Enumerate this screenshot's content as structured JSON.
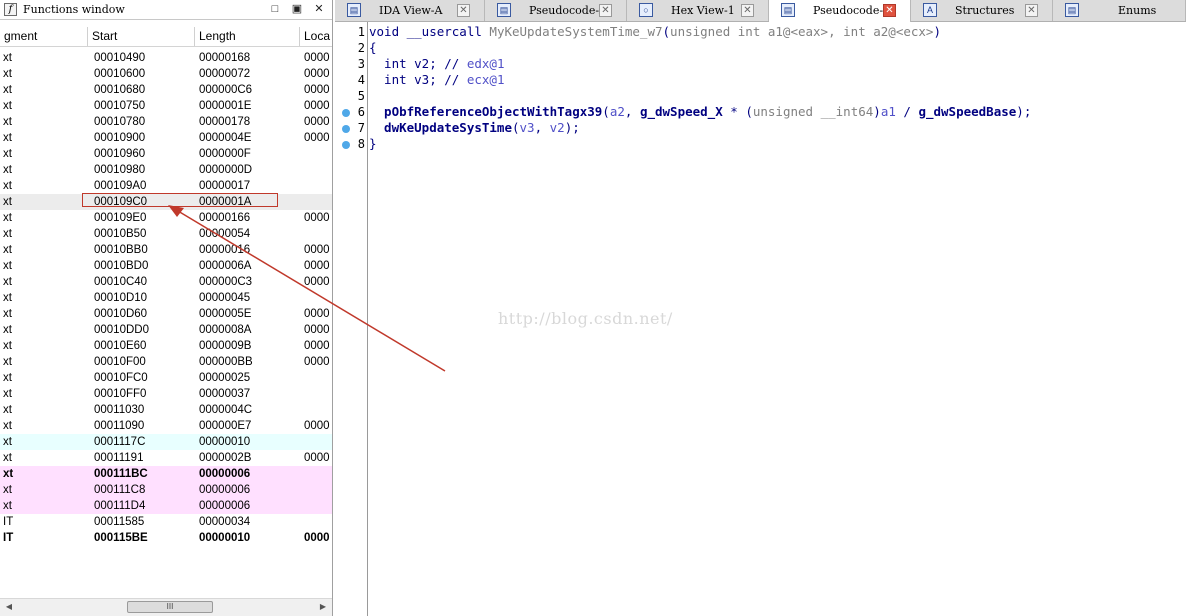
{
  "functions_window": {
    "title": "Functions window",
    "icon": "function-icon",
    "window_buttons": [
      "□",
      "▣",
      "✕"
    ],
    "columns": [
      "gment",
      "Start",
      "Length",
      "Loca"
    ],
    "rows": [
      {
        "seg": "xt",
        "start": "00010490",
        "length": "00000168",
        "loc": "0000",
        "style": ""
      },
      {
        "seg": "xt",
        "start": "00010600",
        "length": "00000072",
        "loc": "0000",
        "style": ""
      },
      {
        "seg": "xt",
        "start": "00010680",
        "length": "000000C6",
        "loc": "0000",
        "style": ""
      },
      {
        "seg": "xt",
        "start": "00010750",
        "length": "0000001E",
        "loc": "0000",
        "style": ""
      },
      {
        "seg": "xt",
        "start": "00010780",
        "length": "00000178",
        "loc": "0000",
        "style": ""
      },
      {
        "seg": "xt",
        "start": "00010900",
        "length": "0000004E",
        "loc": "0000",
        "style": ""
      },
      {
        "seg": "xt",
        "start": "00010960",
        "length": "0000000F",
        "loc": "",
        "style": ""
      },
      {
        "seg": "xt",
        "start": "00010980",
        "length": "0000000D",
        "loc": "",
        "style": ""
      },
      {
        "seg": "xt",
        "start": "000109A0",
        "length": "00000017",
        "loc": "",
        "style": ""
      },
      {
        "seg": "xt",
        "start": "000109C0",
        "length": "0000001A",
        "loc": "",
        "style": "sel"
      },
      {
        "seg": "xt",
        "start": "000109E0",
        "length": "00000166",
        "loc": "0000",
        "style": ""
      },
      {
        "seg": "xt",
        "start": "00010B50",
        "length": "00000054",
        "loc": "",
        "style": ""
      },
      {
        "seg": "xt",
        "start": "00010BB0",
        "length": "00000016",
        "loc": "0000",
        "style": ""
      },
      {
        "seg": "xt",
        "start": "00010BD0",
        "length": "0000006A",
        "loc": "0000",
        "style": ""
      },
      {
        "seg": "xt",
        "start": "00010C40",
        "length": "000000C3",
        "loc": "0000",
        "style": ""
      },
      {
        "seg": "xt",
        "start": "00010D10",
        "length": "00000045",
        "loc": "",
        "style": ""
      },
      {
        "seg": "xt",
        "start": "00010D60",
        "length": "0000005E",
        "loc": "0000",
        "style": ""
      },
      {
        "seg": "xt",
        "start": "00010DD0",
        "length": "0000008A",
        "loc": "0000",
        "style": ""
      },
      {
        "seg": "xt",
        "start": "00010E60",
        "length": "0000009B",
        "loc": "0000",
        "style": ""
      },
      {
        "seg": "xt",
        "start": "00010F00",
        "length": "000000BB",
        "loc": "0000",
        "style": ""
      },
      {
        "seg": "xt",
        "start": "00010FC0",
        "length": "00000025",
        "loc": "",
        "style": ""
      },
      {
        "seg": "xt",
        "start": "00010FF0",
        "length": "00000037",
        "loc": "",
        "style": ""
      },
      {
        "seg": "xt",
        "start": "00011030",
        "length": "0000004C",
        "loc": "",
        "style": ""
      },
      {
        "seg": "xt",
        "start": "00011090",
        "length": "000000E7",
        "loc": "0000",
        "style": ""
      },
      {
        "seg": "xt",
        "start": "0001117C",
        "length": "00000010",
        "loc": "",
        "style": "cyan"
      },
      {
        "seg": "xt",
        "start": "00011191",
        "length": "0000002B",
        "loc": "0000",
        "style": ""
      },
      {
        "seg": "xt",
        "start": "000111BC",
        "length": "00000006",
        "loc": "",
        "style": "pink bold"
      },
      {
        "seg": "xt",
        "start": "000111C8",
        "length": "00000006",
        "loc": "",
        "style": "pink"
      },
      {
        "seg": "xt",
        "start": "000111D4",
        "length": "00000006",
        "loc": "",
        "style": "pink"
      },
      {
        "seg": "IT",
        "start": "00011585",
        "length": "00000034",
        "loc": "",
        "style": ""
      },
      {
        "seg": "IT",
        "start": "000115BE",
        "length": "00000010",
        "loc": "0000",
        "style": "bold"
      }
    ],
    "scrollbar_thumb": "III"
  },
  "tabs": [
    {
      "label": "IDA View-A",
      "icon": "ida-view-icon",
      "active": false,
      "close_red": false
    },
    {
      "label": "Pseudocode-A",
      "icon": "pseudocode-icon",
      "active": false,
      "close_red": false
    },
    {
      "label": "Hex View-1",
      "icon": "hex-view-icon",
      "active": false,
      "close_red": false
    },
    {
      "label": "Pseudocode-B",
      "icon": "pseudocode-icon",
      "active": true,
      "close_red": true
    },
    {
      "label": "Structures",
      "icon": "structures-icon",
      "active": false,
      "close_red": false
    },
    {
      "label": "Enums",
      "icon": "enums-icon",
      "active": false,
      "close_red": false
    }
  ],
  "pseudocode": {
    "lines": [
      {
        "n": "1",
        "dot": false,
        "tokens": [
          [
            "kw",
            "void __usercall "
          ],
          [
            "gr",
            "MyKeUpdateSystemTime_w7"
          ],
          [
            "kw",
            "("
          ],
          [
            "gr",
            "unsigned int a1@<eax>, int a2@<ecx>"
          ],
          [
            "kw",
            ")"
          ]
        ]
      },
      {
        "n": "2",
        "dot": false,
        "tokens": [
          [
            "kw",
            "{"
          ]
        ]
      },
      {
        "n": "3",
        "dot": false,
        "tokens": [
          [
            "kw",
            "  int v2; // "
          ],
          [
            "cm",
            "edx@1"
          ]
        ]
      },
      {
        "n": "4",
        "dot": false,
        "tokens": [
          [
            "kw",
            "  int v3; // "
          ],
          [
            "cm",
            "ecx@1"
          ]
        ]
      },
      {
        "n": "5",
        "dot": false,
        "tokens": []
      },
      {
        "n": "6",
        "dot": true,
        "tokens": [
          [
            "id",
            "  pObfReferenceObjectWithTagx39"
          ],
          [
            "kw",
            "("
          ],
          [
            "cm",
            "a2"
          ],
          [
            "kw",
            ", "
          ],
          [
            "id",
            "g_dwSpeed_X"
          ],
          [
            "kw",
            " * ("
          ],
          [
            "gr",
            "unsigned __int64"
          ],
          [
            "kw",
            ")"
          ],
          [
            "cm",
            "a1"
          ],
          [
            "kw",
            " / "
          ],
          [
            "id",
            "g_dwSpeedBase"
          ],
          [
            "kw",
            ");"
          ]
        ]
      },
      {
        "n": "7",
        "dot": true,
        "tokens": [
          [
            "id",
            "  dwKeUpdateSysTime"
          ],
          [
            "kw",
            "("
          ],
          [
            "cm",
            "v3"
          ],
          [
            "kw",
            ", "
          ],
          [
            "cm",
            "v2"
          ],
          [
            "kw",
            ");"
          ]
        ]
      },
      {
        "n": "8",
        "dot": true,
        "tokens": [
          [
            "kw",
            "}"
          ]
        ]
      }
    ]
  },
  "watermark": "http://blog.csdn.net/",
  "colors": {
    "annotation_red": "#c0392b",
    "breakpoint_dot": "#4fa8e8",
    "keyword": "#000080"
  }
}
